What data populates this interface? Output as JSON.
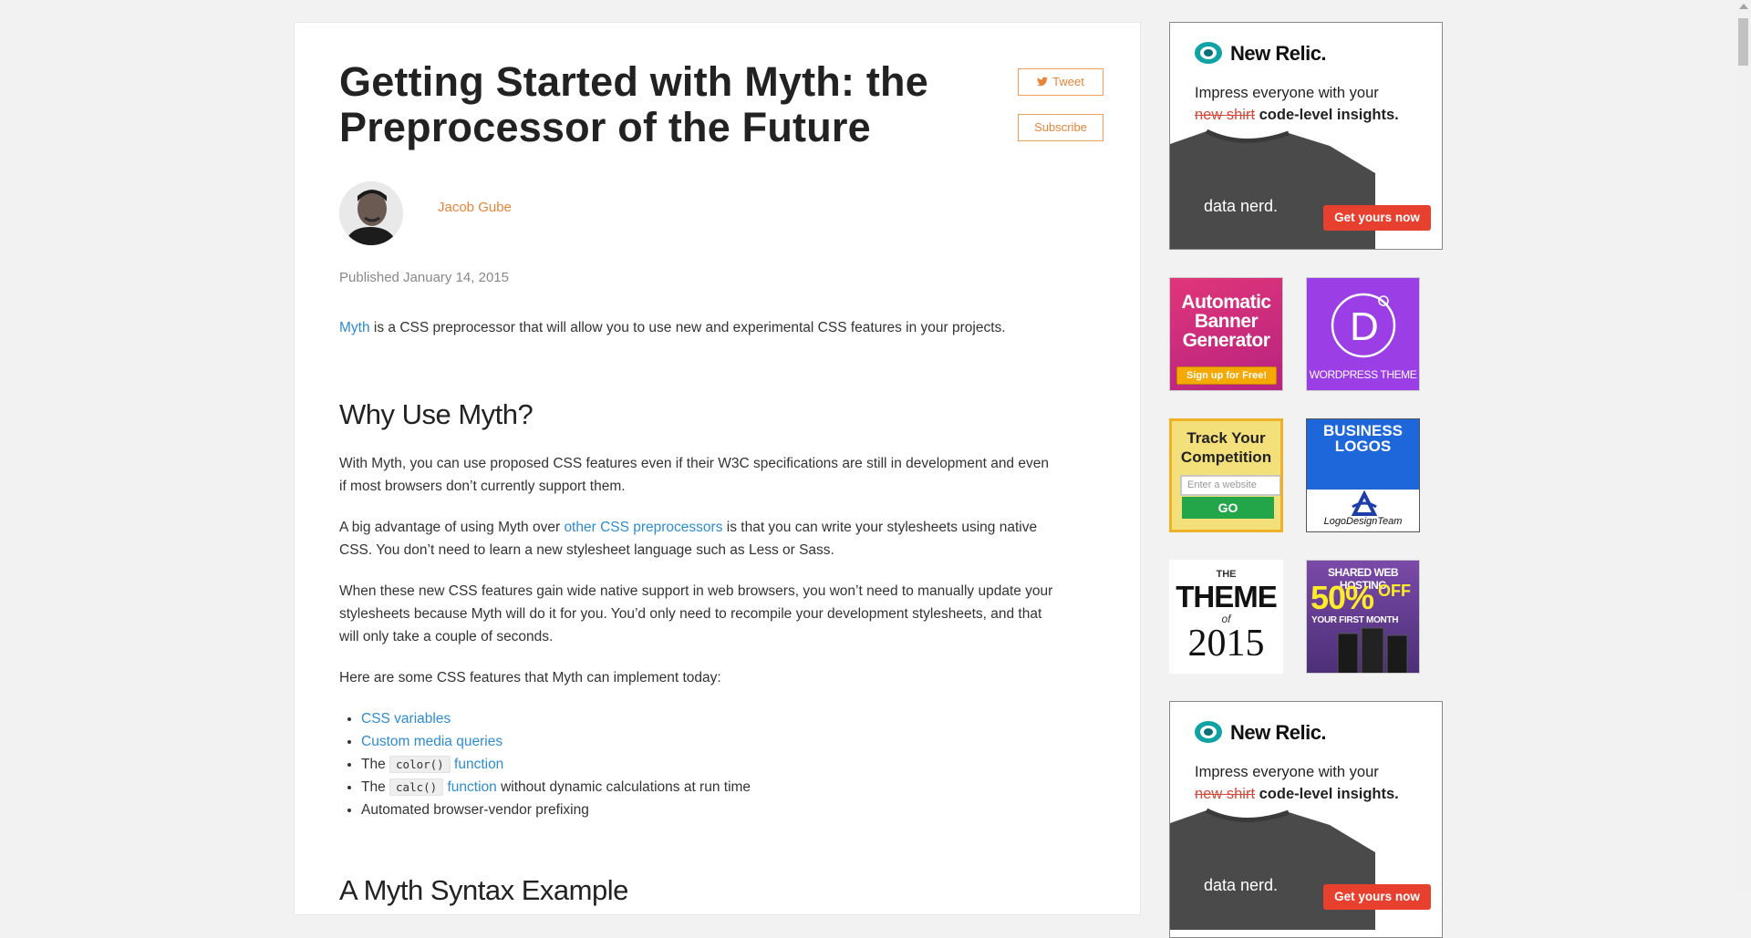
{
  "article": {
    "title": "Getting Started with Myth: the Preprocessor of the Future",
    "tweet_label": "Tweet",
    "subscribe_label": "Subscribe",
    "author": "Jacob Gube",
    "published": "Published January 14, 2015",
    "intro_link": "Myth",
    "intro_rest": " is a CSS preprocessor that will allow you to use new and experimental CSS features in your projects.",
    "h_why": "Why Use Myth?",
    "p1": "With Myth, you can use proposed CSS features even if their W3C specifications are still in development and even if most browsers don’t currently support them.",
    "p2_a": "A big advantage of using Myth over ",
    "p2_link": "other CSS preprocessors",
    "p2_b": " is that you can write your stylesheets using native CSS. You don’t need to learn a new stylesheet language such as Less or Sass.",
    "p3": "When these new CSS features gain wide native support in web browsers, you won’t need to manually update your stylesheets because Myth will do it for you. You’d only need to recompile your development stylesheets, and that will only take a couple of seconds.",
    "p4": "Here are some CSS features that Myth can implement today:",
    "list": {
      "item1": "CSS variables",
      "item2": "Custom media queries",
      "item3_pre": "The ",
      "item3_code": "color()",
      "item3_link": "function",
      "item4_pre": "The ",
      "item4_code": "calc()",
      "item4_link": "function",
      "item4_post": " without dynamic calculations at run time",
      "item5": "Automated browser-vendor prefixing"
    },
    "h_syntax": "A Myth Syntax Example"
  },
  "sidebar": {
    "newrelic": {
      "brand": "New Relic.",
      "line1": "Impress everyone with your",
      "strike": "new shirt",
      "bold": " code-level insights.",
      "shirt_text": "data nerd.",
      "cta": "Get yours now"
    },
    "banner": {
      "text": "Automatic Banner Generator",
      "line1": "Automatic",
      "line2": "Banner",
      "line3": "Generator",
      "cta": "Sign up for Free!"
    },
    "divi": {
      "label": "WORDPRESS THEME",
      "letter": "D"
    },
    "track": {
      "line1": "Track Your",
      "line2": "Competition",
      "placeholder": "Enter a website",
      "go": "GO"
    },
    "logos": {
      "line1": "BUSINESS",
      "line2": "LOGOS",
      "brand": "LogoDesignTeam"
    },
    "theme": {
      "the": "THE",
      "big": "THEME",
      "of": "of",
      "year": "2015"
    },
    "hosting": {
      "title": "SHARED WEB HOSTING",
      "pct": "50%",
      "off": "OFF",
      "sub": "YOUR FIRST MONTH"
    }
  },
  "colors": {
    "accent": "#e8843a",
    "link": "#2e8ccf",
    "newrelic_cta": "#e8402e"
  }
}
